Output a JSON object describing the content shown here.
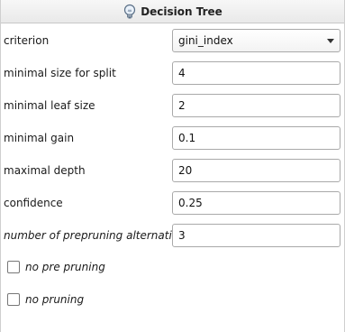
{
  "header": {
    "title": "Decision Tree",
    "icon": "lightbulb-icon"
  },
  "params": {
    "criterion": {
      "label": "criterion",
      "value": "gini_index"
    },
    "min_split": {
      "label": "minimal size for split",
      "value": "4"
    },
    "min_leaf": {
      "label": "minimal leaf size",
      "value": "2"
    },
    "min_gain": {
      "label": "minimal gain",
      "value": "0.1"
    },
    "max_depth": {
      "label": "maximal depth",
      "value": "20"
    },
    "confidence": {
      "label": "confidence",
      "value": "0.25"
    },
    "prepruning_alts": {
      "label": "number of prepruning alternativ...",
      "value": "3"
    }
  },
  "checkboxes": {
    "no_pre_pruning": {
      "label": "no pre pruning",
      "checked": false
    },
    "no_pruning": {
      "label": "no pruning",
      "checked": false
    }
  }
}
